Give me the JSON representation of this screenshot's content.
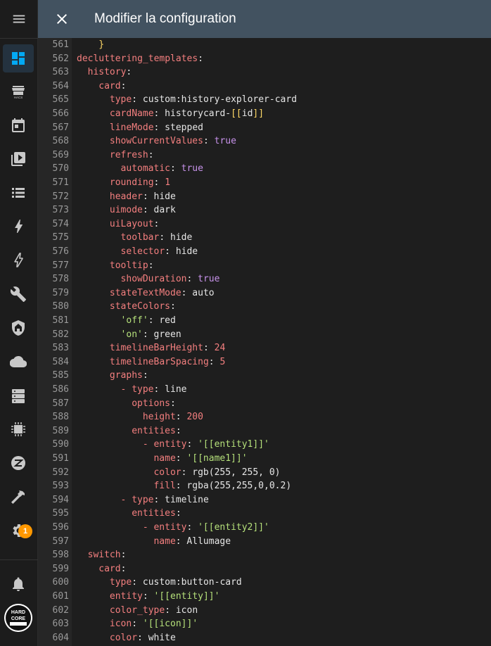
{
  "header": {
    "title": "Modifier la configuration"
  },
  "sidebar": {
    "items": [
      {
        "icon": "dashboard-icon",
        "active": true
      },
      {
        "icon": "hacs-icon",
        "label": "HACS"
      },
      {
        "icon": "calendar-icon"
      },
      {
        "icon": "media-icon"
      },
      {
        "icon": "logbook-icon"
      },
      {
        "icon": "energy-icon"
      },
      {
        "icon": "power-icon"
      },
      {
        "icon": "wrench-icon"
      },
      {
        "icon": "security-icon"
      },
      {
        "icon": "cloud-icon"
      },
      {
        "icon": "server-icon"
      },
      {
        "icon": "chip-icon"
      },
      {
        "icon": "zigbee-icon"
      },
      {
        "icon": "hammer-icon"
      },
      {
        "icon": "settings-icon"
      }
    ],
    "settings_badge": "1",
    "notifications_icon": "bell-icon",
    "avatar_text": "HARD CORE"
  },
  "editor": {
    "lines": [
      {
        "n": "561",
        "indent": 4,
        "parts": [
          [
            "br",
            "}"
          ]
        ]
      },
      {
        "n": "562",
        "indent": 0,
        "parts": [
          [
            "k",
            "decluttering_templates"
          ],
          [
            "p",
            ":"
          ]
        ]
      },
      {
        "n": "563",
        "indent": 2,
        "parts": [
          [
            "k",
            "history"
          ],
          [
            "p",
            ":"
          ]
        ]
      },
      {
        "n": "564",
        "indent": 4,
        "parts": [
          [
            "k",
            "card"
          ],
          [
            "p",
            ":"
          ]
        ]
      },
      {
        "n": "565",
        "indent": 6,
        "parts": [
          [
            "k",
            "type"
          ],
          [
            "p",
            ": custom:history-explorer-card"
          ]
        ]
      },
      {
        "n": "566",
        "indent": 6,
        "parts": [
          [
            "k",
            "cardName"
          ],
          [
            "p",
            ": historycard-"
          ],
          [
            "br",
            "[["
          ],
          [
            "p",
            "id"
          ],
          [
            "br",
            "]]"
          ]
        ]
      },
      {
        "n": "567",
        "indent": 6,
        "parts": [
          [
            "k",
            "lineMode"
          ],
          [
            "p",
            ": stepped"
          ]
        ]
      },
      {
        "n": "568",
        "indent": 6,
        "parts": [
          [
            "k",
            "showCurrentValues"
          ],
          [
            "p",
            ": "
          ],
          [
            "b",
            "true"
          ]
        ]
      },
      {
        "n": "569",
        "indent": 6,
        "parts": [
          [
            "k",
            "refresh"
          ],
          [
            "p",
            ":"
          ]
        ]
      },
      {
        "n": "570",
        "indent": 8,
        "parts": [
          [
            "k",
            "automatic"
          ],
          [
            "p",
            ": "
          ],
          [
            "b",
            "true"
          ]
        ]
      },
      {
        "n": "571",
        "indent": 6,
        "parts": [
          [
            "k",
            "rounding"
          ],
          [
            "p",
            ": "
          ],
          [
            "n",
            "1"
          ]
        ]
      },
      {
        "n": "572",
        "indent": 6,
        "parts": [
          [
            "k",
            "header"
          ],
          [
            "p",
            ": hide"
          ]
        ]
      },
      {
        "n": "573",
        "indent": 6,
        "parts": [
          [
            "k",
            "uimode"
          ],
          [
            "p",
            ": dark"
          ]
        ]
      },
      {
        "n": "574",
        "indent": 6,
        "parts": [
          [
            "k",
            "uiLayout"
          ],
          [
            "p",
            ":"
          ]
        ]
      },
      {
        "n": "575",
        "indent": 8,
        "parts": [
          [
            "k",
            "toolbar"
          ],
          [
            "p",
            ": hide"
          ]
        ]
      },
      {
        "n": "576",
        "indent": 8,
        "parts": [
          [
            "k",
            "selector"
          ],
          [
            "p",
            ": hide"
          ]
        ]
      },
      {
        "n": "577",
        "indent": 6,
        "parts": [
          [
            "k",
            "tooltip"
          ],
          [
            "p",
            ":"
          ]
        ]
      },
      {
        "n": "578",
        "indent": 8,
        "parts": [
          [
            "k",
            "showDuration"
          ],
          [
            "p",
            ": "
          ],
          [
            "b",
            "true"
          ]
        ]
      },
      {
        "n": "579",
        "indent": 6,
        "parts": [
          [
            "k",
            "stateTextMode"
          ],
          [
            "p",
            ": auto"
          ]
        ]
      },
      {
        "n": "580",
        "indent": 6,
        "parts": [
          [
            "k",
            "stateColors"
          ],
          [
            "p",
            ":"
          ]
        ]
      },
      {
        "n": "581",
        "indent": 8,
        "parts": [
          [
            "s",
            "'off'"
          ],
          [
            "p",
            ": red"
          ]
        ]
      },
      {
        "n": "582",
        "indent": 8,
        "parts": [
          [
            "s",
            "'on'"
          ],
          [
            "p",
            ": green"
          ]
        ]
      },
      {
        "n": "583",
        "indent": 6,
        "parts": [
          [
            "k",
            "timelineBarHeight"
          ],
          [
            "p",
            ": "
          ],
          [
            "n",
            "24"
          ]
        ]
      },
      {
        "n": "584",
        "indent": 6,
        "parts": [
          [
            "k",
            "timelineBarSpacing"
          ],
          [
            "p",
            ": "
          ],
          [
            "n",
            "5"
          ]
        ]
      },
      {
        "n": "585",
        "indent": 6,
        "parts": [
          [
            "k",
            "graphs"
          ],
          [
            "p",
            ":"
          ]
        ]
      },
      {
        "n": "586",
        "indent": 8,
        "parts": [
          [
            "k",
            "- "
          ],
          [
            "k",
            "type"
          ],
          [
            "p",
            ": line"
          ]
        ]
      },
      {
        "n": "587",
        "indent": 10,
        "parts": [
          [
            "k",
            "options"
          ],
          [
            "p",
            ":"
          ]
        ]
      },
      {
        "n": "588",
        "indent": 12,
        "parts": [
          [
            "k",
            "height"
          ],
          [
            "p",
            ": "
          ],
          [
            "n",
            "200"
          ]
        ]
      },
      {
        "n": "589",
        "indent": 10,
        "parts": [
          [
            "k",
            "entities"
          ],
          [
            "p",
            ":"
          ]
        ]
      },
      {
        "n": "590",
        "indent": 12,
        "parts": [
          [
            "k",
            "- "
          ],
          [
            "k",
            "entity"
          ],
          [
            "p",
            ": "
          ],
          [
            "s",
            "'[[entity1]]'"
          ]
        ]
      },
      {
        "n": "591",
        "indent": 14,
        "parts": [
          [
            "k",
            "name"
          ],
          [
            "p",
            ": "
          ],
          [
            "s",
            "'[[name1]]'"
          ]
        ]
      },
      {
        "n": "592",
        "indent": 14,
        "parts": [
          [
            "k",
            "color"
          ],
          [
            "p",
            ": rgb(255, 255, 0)"
          ]
        ]
      },
      {
        "n": "593",
        "indent": 14,
        "parts": [
          [
            "k",
            "fill"
          ],
          [
            "p",
            ": rgba(255,255,0,0.2)"
          ]
        ]
      },
      {
        "n": "594",
        "indent": 8,
        "parts": [
          [
            "k",
            "- "
          ],
          [
            "k",
            "type"
          ],
          [
            "p",
            ": timeline"
          ]
        ]
      },
      {
        "n": "595",
        "indent": 10,
        "parts": [
          [
            "k",
            "entities"
          ],
          [
            "p",
            ":"
          ]
        ]
      },
      {
        "n": "596",
        "indent": 12,
        "parts": [
          [
            "k",
            "- "
          ],
          [
            "k",
            "entity"
          ],
          [
            "p",
            ": "
          ],
          [
            "s",
            "'[[entity2]]'"
          ]
        ]
      },
      {
        "n": "597",
        "indent": 14,
        "parts": [
          [
            "k",
            "name"
          ],
          [
            "p",
            ": Allumage"
          ]
        ]
      },
      {
        "n": "598",
        "indent": 2,
        "parts": [
          [
            "k",
            "switch"
          ],
          [
            "p",
            ":"
          ]
        ]
      },
      {
        "n": "599",
        "indent": 4,
        "parts": [
          [
            "k",
            "card"
          ],
          [
            "p",
            ":"
          ]
        ]
      },
      {
        "n": "600",
        "indent": 6,
        "parts": [
          [
            "k",
            "type"
          ],
          [
            "p",
            ": custom:button-card"
          ]
        ]
      },
      {
        "n": "601",
        "indent": 6,
        "parts": [
          [
            "k",
            "entity"
          ],
          [
            "p",
            ": "
          ],
          [
            "s",
            "'[[entity]]'"
          ]
        ]
      },
      {
        "n": "602",
        "indent": 6,
        "parts": [
          [
            "k",
            "color_type"
          ],
          [
            "p",
            ": icon"
          ]
        ]
      },
      {
        "n": "603",
        "indent": 6,
        "parts": [
          [
            "k",
            "icon"
          ],
          [
            "p",
            ": "
          ],
          [
            "s",
            "'[[icon]]'"
          ]
        ]
      },
      {
        "n": "604",
        "indent": 6,
        "parts": [
          [
            "k",
            "color"
          ],
          [
            "p",
            ": white"
          ]
        ]
      }
    ]
  }
}
